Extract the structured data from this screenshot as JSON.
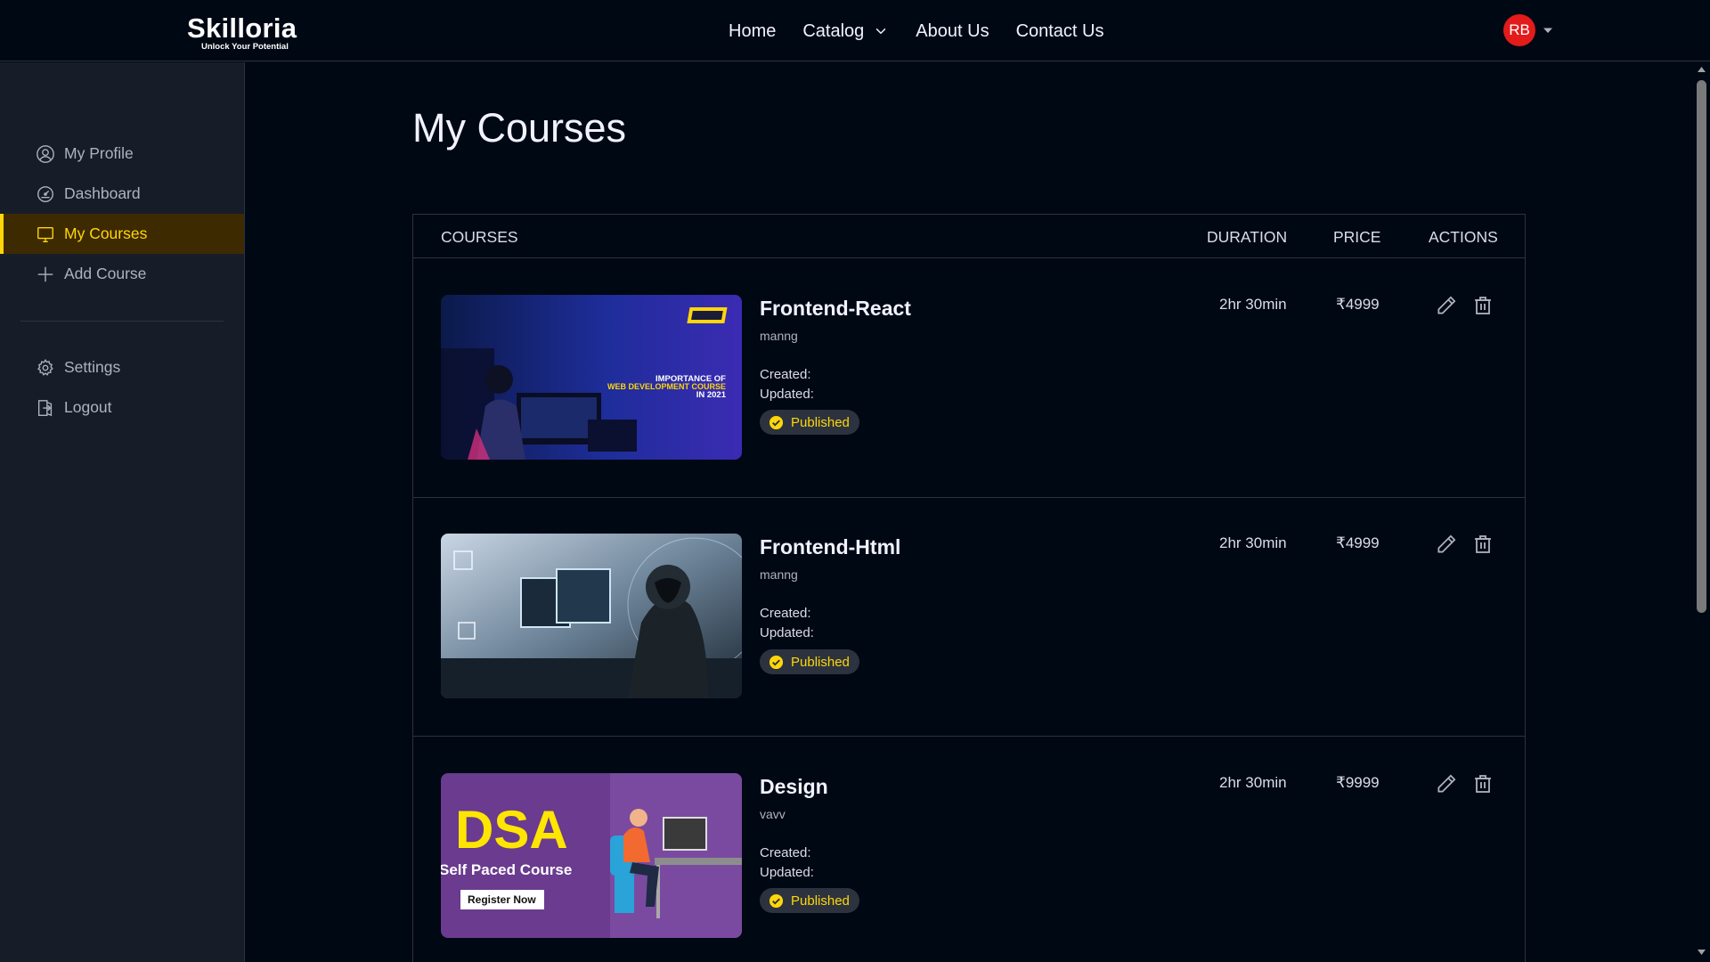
{
  "brand": {
    "name": "Skilloria",
    "tagline": "Unlock Your Potential"
  },
  "nav": {
    "home": "Home",
    "catalog": "Catalog",
    "about": "About Us",
    "contact": "Contact Us"
  },
  "user": {
    "initials": "RB"
  },
  "sidebar": {
    "items": [
      {
        "label": "My Profile",
        "icon": "user-circle-icon"
      },
      {
        "label": "Dashboard",
        "icon": "gauge-icon"
      },
      {
        "label": "My Courses",
        "icon": "monitor-icon",
        "active": true
      },
      {
        "label": "Add Course",
        "icon": "plus-icon"
      },
      {
        "label": "Settings",
        "icon": "gear-icon"
      },
      {
        "label": "Logout",
        "icon": "logout-icon"
      }
    ]
  },
  "page": {
    "title": "My Courses"
  },
  "table": {
    "headers": {
      "courses": "COURSES",
      "duration": "DURATION",
      "price": "PRICE",
      "actions": "ACTIONS"
    },
    "rows": [
      {
        "title": "Frontend-React",
        "description": "manng",
        "created": "Created:",
        "updated": "Updated:",
        "status": "Published",
        "duration": "2hr 30min",
        "price": "₹4999",
        "thumbnail_text": [
          "IMPORTANCE OF",
          "WEB DEVELOPMENT COURSE",
          "IN 2021"
        ]
      },
      {
        "title": "Frontend-Html",
        "description": "manng",
        "created": "Created:",
        "updated": "Updated:",
        "status": "Published",
        "duration": "2hr 30min",
        "price": "₹4999"
      },
      {
        "title": "Design",
        "description": "vavv",
        "created": "Created:",
        "updated": "Updated:",
        "status": "Published",
        "duration": "2hr 30min",
        "price": "₹9999",
        "thumbnail_text": [
          "DSA",
          "Self Paced Course",
          "Register Now"
        ]
      }
    ]
  },
  "colors": {
    "background": "#000814",
    "sidebar": "#161d29",
    "accent": "#ffd60a",
    "active_bg": "#3d2a01",
    "avatar": "#e31b1b"
  }
}
